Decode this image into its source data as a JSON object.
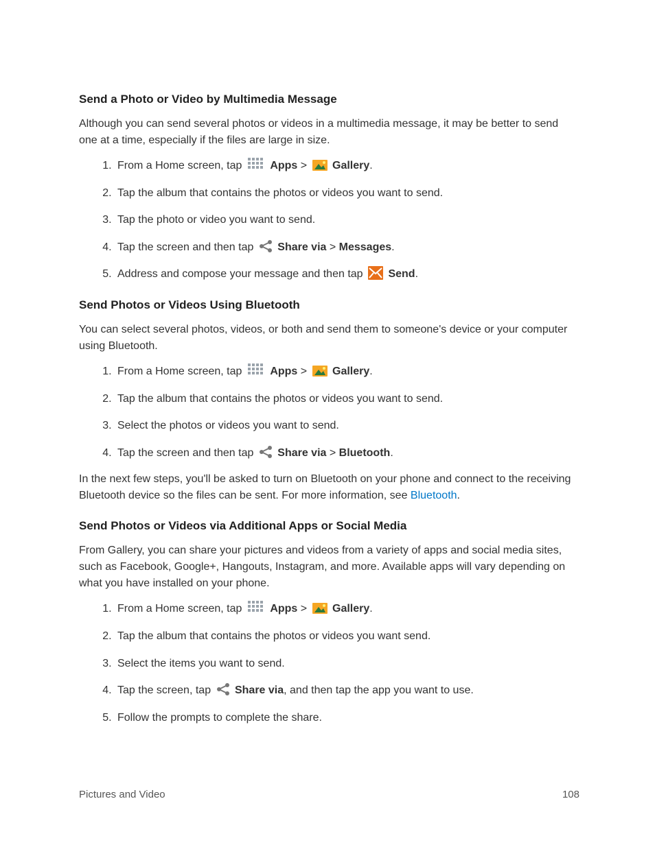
{
  "section1": {
    "title": "Send a Photo or Video by Multimedia Message",
    "intro": "Although you can send several photos or videos in a multimedia message, it may be better to send one at a time, especially if the files are large in size.",
    "steps": {
      "s1a": "From a Home screen, tap",
      "s1_apps": "Apps",
      "s1_sep": " > ",
      "s1_gallery": "Gallery",
      "s1_end": ".",
      "s2": "Tap the album that contains the photos or videos you want to send.",
      "s3": "Tap the photo or video you want to send.",
      "s4a": "Tap the screen and then tap ",
      "s4_share": "Share via",
      "s4_sep": " > ",
      "s4_messages": "Messages",
      "s4_end": ".",
      "s5a": "Address and compose your message and then tap ",
      "s5_send": "Send",
      "s5_end": "."
    }
  },
  "section2": {
    "title": "Send Photos or Videos Using Bluetooth",
    "intro": "You can select several photos, videos, or both and send them to someone's device or your computer using Bluetooth.",
    "steps": {
      "s1a": "From a Home screen, tap",
      "s1_apps": "Apps",
      "s1_sep": " > ",
      "s1_gallery": "Gallery",
      "s1_end": ".",
      "s2": "Tap the album that contains the photos or videos you want to send.",
      "s3": "Select the photos or videos you want to send.",
      "s4a": "Tap the screen and then tap ",
      "s4_share": "Share via",
      "s4_sep": " > ",
      "s4_bluetooth": "Bluetooth",
      "s4_end": "."
    },
    "outro_a": "In the next few steps, you'll be asked to turn on Bluetooth on your phone and connect to the receiving Bluetooth device so the files can be sent. For more information, see ",
    "outro_link": "Bluetooth",
    "outro_end": "."
  },
  "section3": {
    "title": "Send Photos or Videos via Additional Apps or Social Media",
    "intro": "From Gallery, you can share your pictures and videos from a variety of apps and social media sites, such as Facebook, Google+, Hangouts, Instagram, and more. Available apps will vary depending on what you have installed on your phone.",
    "steps": {
      "s1a": "From a Home screen, tap",
      "s1_apps": "Apps",
      "s1_sep": " > ",
      "s1_gallery": "Gallery",
      "s1_end": ".",
      "s2": "Tap the album that contains the photos or videos you want send.",
      "s3": "Select the items you want to send.",
      "s4a": "Tap the screen, tap ",
      "s4_share": "Share via",
      "s4_mid": ", and then tap the app you want to use.",
      "s5": "Follow the prompts to complete the share."
    }
  },
  "footer": {
    "left": "Pictures and Video",
    "right": "108"
  }
}
